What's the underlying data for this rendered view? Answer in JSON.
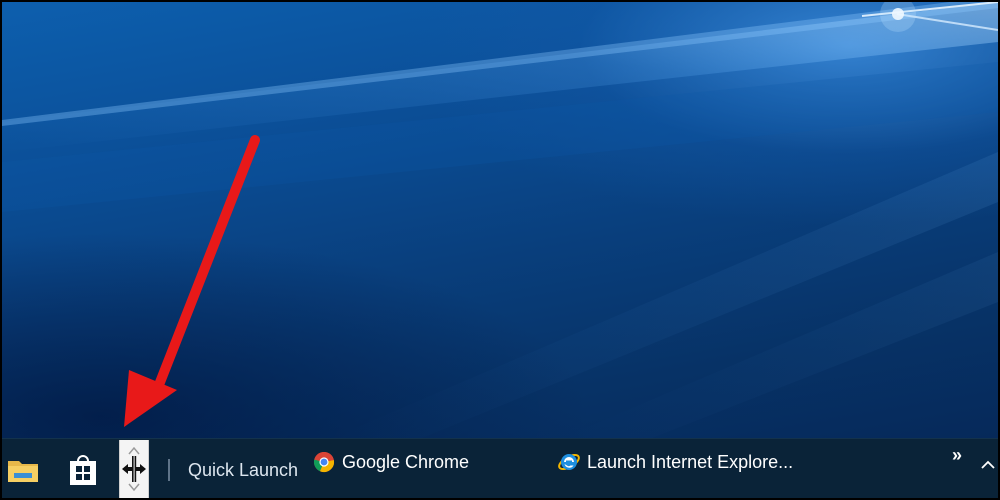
{
  "desktop": {
    "wallpaper": "windows-10-hero",
    "colors": {
      "wallpaper_base": "#0a3f7d",
      "light_beam": "#9fd0ff",
      "taskbar": "#0a2338",
      "annotation_arrow": "#e81919"
    }
  },
  "taskbar": {
    "pinned": [
      {
        "name": "file-explorer",
        "icon": "folder-icon"
      },
      {
        "name": "store",
        "icon": "store-bag-icon"
      }
    ],
    "resize_cursor_icon": "resize-horizontal-cursor-icon",
    "toolbar": {
      "label": "Quick Launch",
      "items": [
        {
          "label": "Google Chrome",
          "icon": "chrome-icon"
        },
        {
          "label": "Launch Internet Explore...",
          "icon": "internet-explorer-icon"
        }
      ],
      "overflow": "»"
    },
    "tray_expand_icon": "chevron-up-icon"
  },
  "annotation": {
    "type": "arrow",
    "color": "#e81919",
    "points_to": "toolbar-resize-handle"
  }
}
